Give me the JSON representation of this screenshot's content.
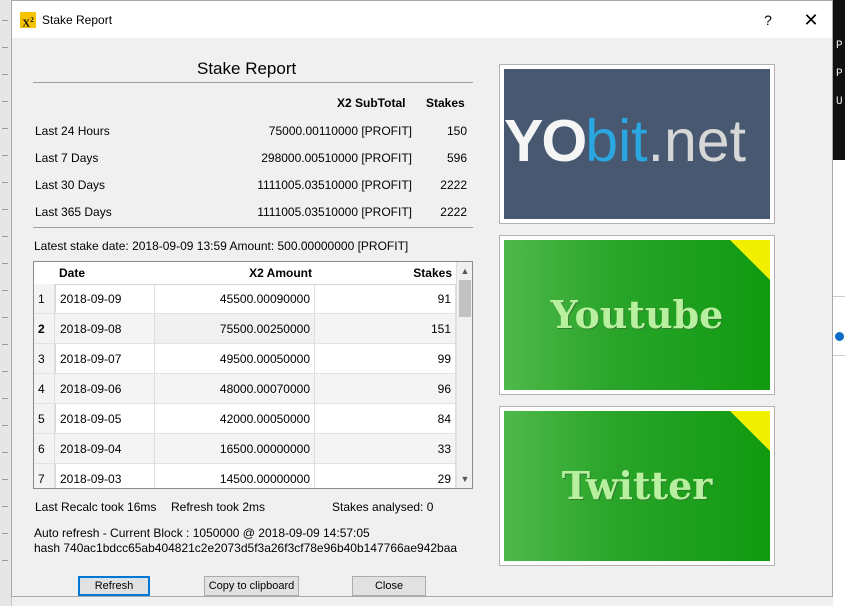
{
  "window": {
    "title": "Stake Report",
    "help": "?",
    "close": "✕",
    "icon_text": "X²"
  },
  "heading": "Stake Report",
  "summary": {
    "col_subtotal": "X2 SubTotal",
    "col_stakes": "Stakes",
    "rows": [
      {
        "label": "Last 24 Hours",
        "value": "75000.00110000 [PROFIT]",
        "stakes": "150"
      },
      {
        "label": "Last 7 Days",
        "value": "298000.00510000 [PROFIT]",
        "stakes": "596"
      },
      {
        "label": "Last 30 Days",
        "value": "1111005.03510000 [PROFIT]",
        "stakes": "2222"
      },
      {
        "label": "Last 365 Days",
        "value": "1111005.03510000 [PROFIT]",
        "stakes": "2222"
      }
    ]
  },
  "latest": "Latest stake date: 2018-09-09 13:59   Amount: 500.00000000 [PROFIT]",
  "table": {
    "headers": [
      "Date",
      "X2 Amount",
      "Stakes"
    ],
    "rows": [
      {
        "n": "1",
        "date": "2018-09-09",
        "amount": "45500.00090000",
        "stakes": "91"
      },
      {
        "n": "2",
        "date": "2018-09-08",
        "amount": "75500.00250000",
        "stakes": "151"
      },
      {
        "n": "3",
        "date": "2018-09-07",
        "amount": "49500.00050000",
        "stakes": "99"
      },
      {
        "n": "4",
        "date": "2018-09-06",
        "amount": "48000.00070000",
        "stakes": "96"
      },
      {
        "n": "5",
        "date": "2018-09-05",
        "amount": "42000.00050000",
        "stakes": "84"
      },
      {
        "n": "6",
        "date": "2018-09-04",
        "amount": "16500.00000000",
        "stakes": "33"
      },
      {
        "n": "7",
        "date": "2018-09-03",
        "amount": "14500.00000000",
        "stakes": "29"
      }
    ]
  },
  "status": {
    "recalc": "Last Recalc took 16ms",
    "refresh": "Refresh took 2ms",
    "analysed": "Stakes analysed: 0"
  },
  "auto_refresh": "Auto refresh  -  Current Block : 1050000 @ 2018-09-09 14:57:05",
  "hash": "hash 740ac1bdcc65ab404821c2e2073d5f3a26f3cf78e96b40b147766ae942baa",
  "buttons": {
    "refresh": "Refresh",
    "copy": "Copy to clipboard",
    "close": "Close"
  },
  "banners": {
    "yobit": {
      "yo": "YO",
      "bit": "bit",
      "net": ".net"
    },
    "youtube": "Youtube",
    "twitter": "Twitter"
  },
  "colors": {
    "yobit_bg": "#475870",
    "green": "#1a9e1a",
    "corner": "#f0f000",
    "focus": "#0078d7"
  }
}
